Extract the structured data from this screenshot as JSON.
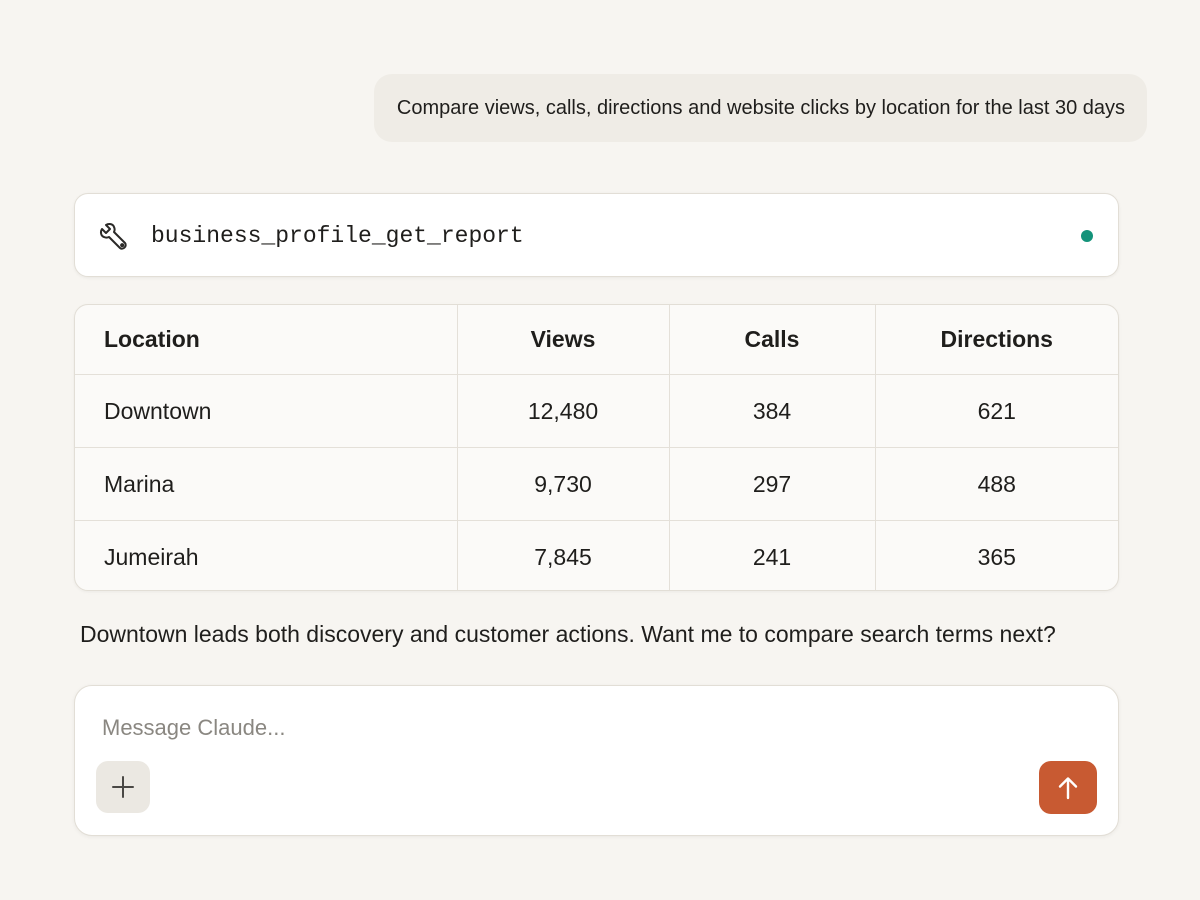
{
  "user_message": {
    "text": "Compare views, calls, directions and website clicks by location for the last 30 days"
  },
  "tool_call": {
    "name": "business_profile_get_report",
    "icon": "wrench-icon",
    "status_color": "#14937a"
  },
  "report_table": {
    "headers": [
      "Location",
      "Views",
      "Calls",
      "Directions"
    ],
    "rows": [
      [
        "Downtown",
        "12,480",
        "384",
        "621"
      ],
      [
        "Marina",
        "9,730",
        "297",
        "488"
      ],
      [
        "Jumeirah",
        "7,845",
        "241",
        "365"
      ]
    ]
  },
  "assistant_reply": {
    "text": "Downtown leads both discovery and customer actions. Want me to compare search terms next?"
  },
  "composer": {
    "placeholder": "Message Claude...",
    "value": "",
    "add_icon": "plus-icon",
    "send_icon": "arrow-up-icon",
    "send_color": "#c85a32"
  }
}
